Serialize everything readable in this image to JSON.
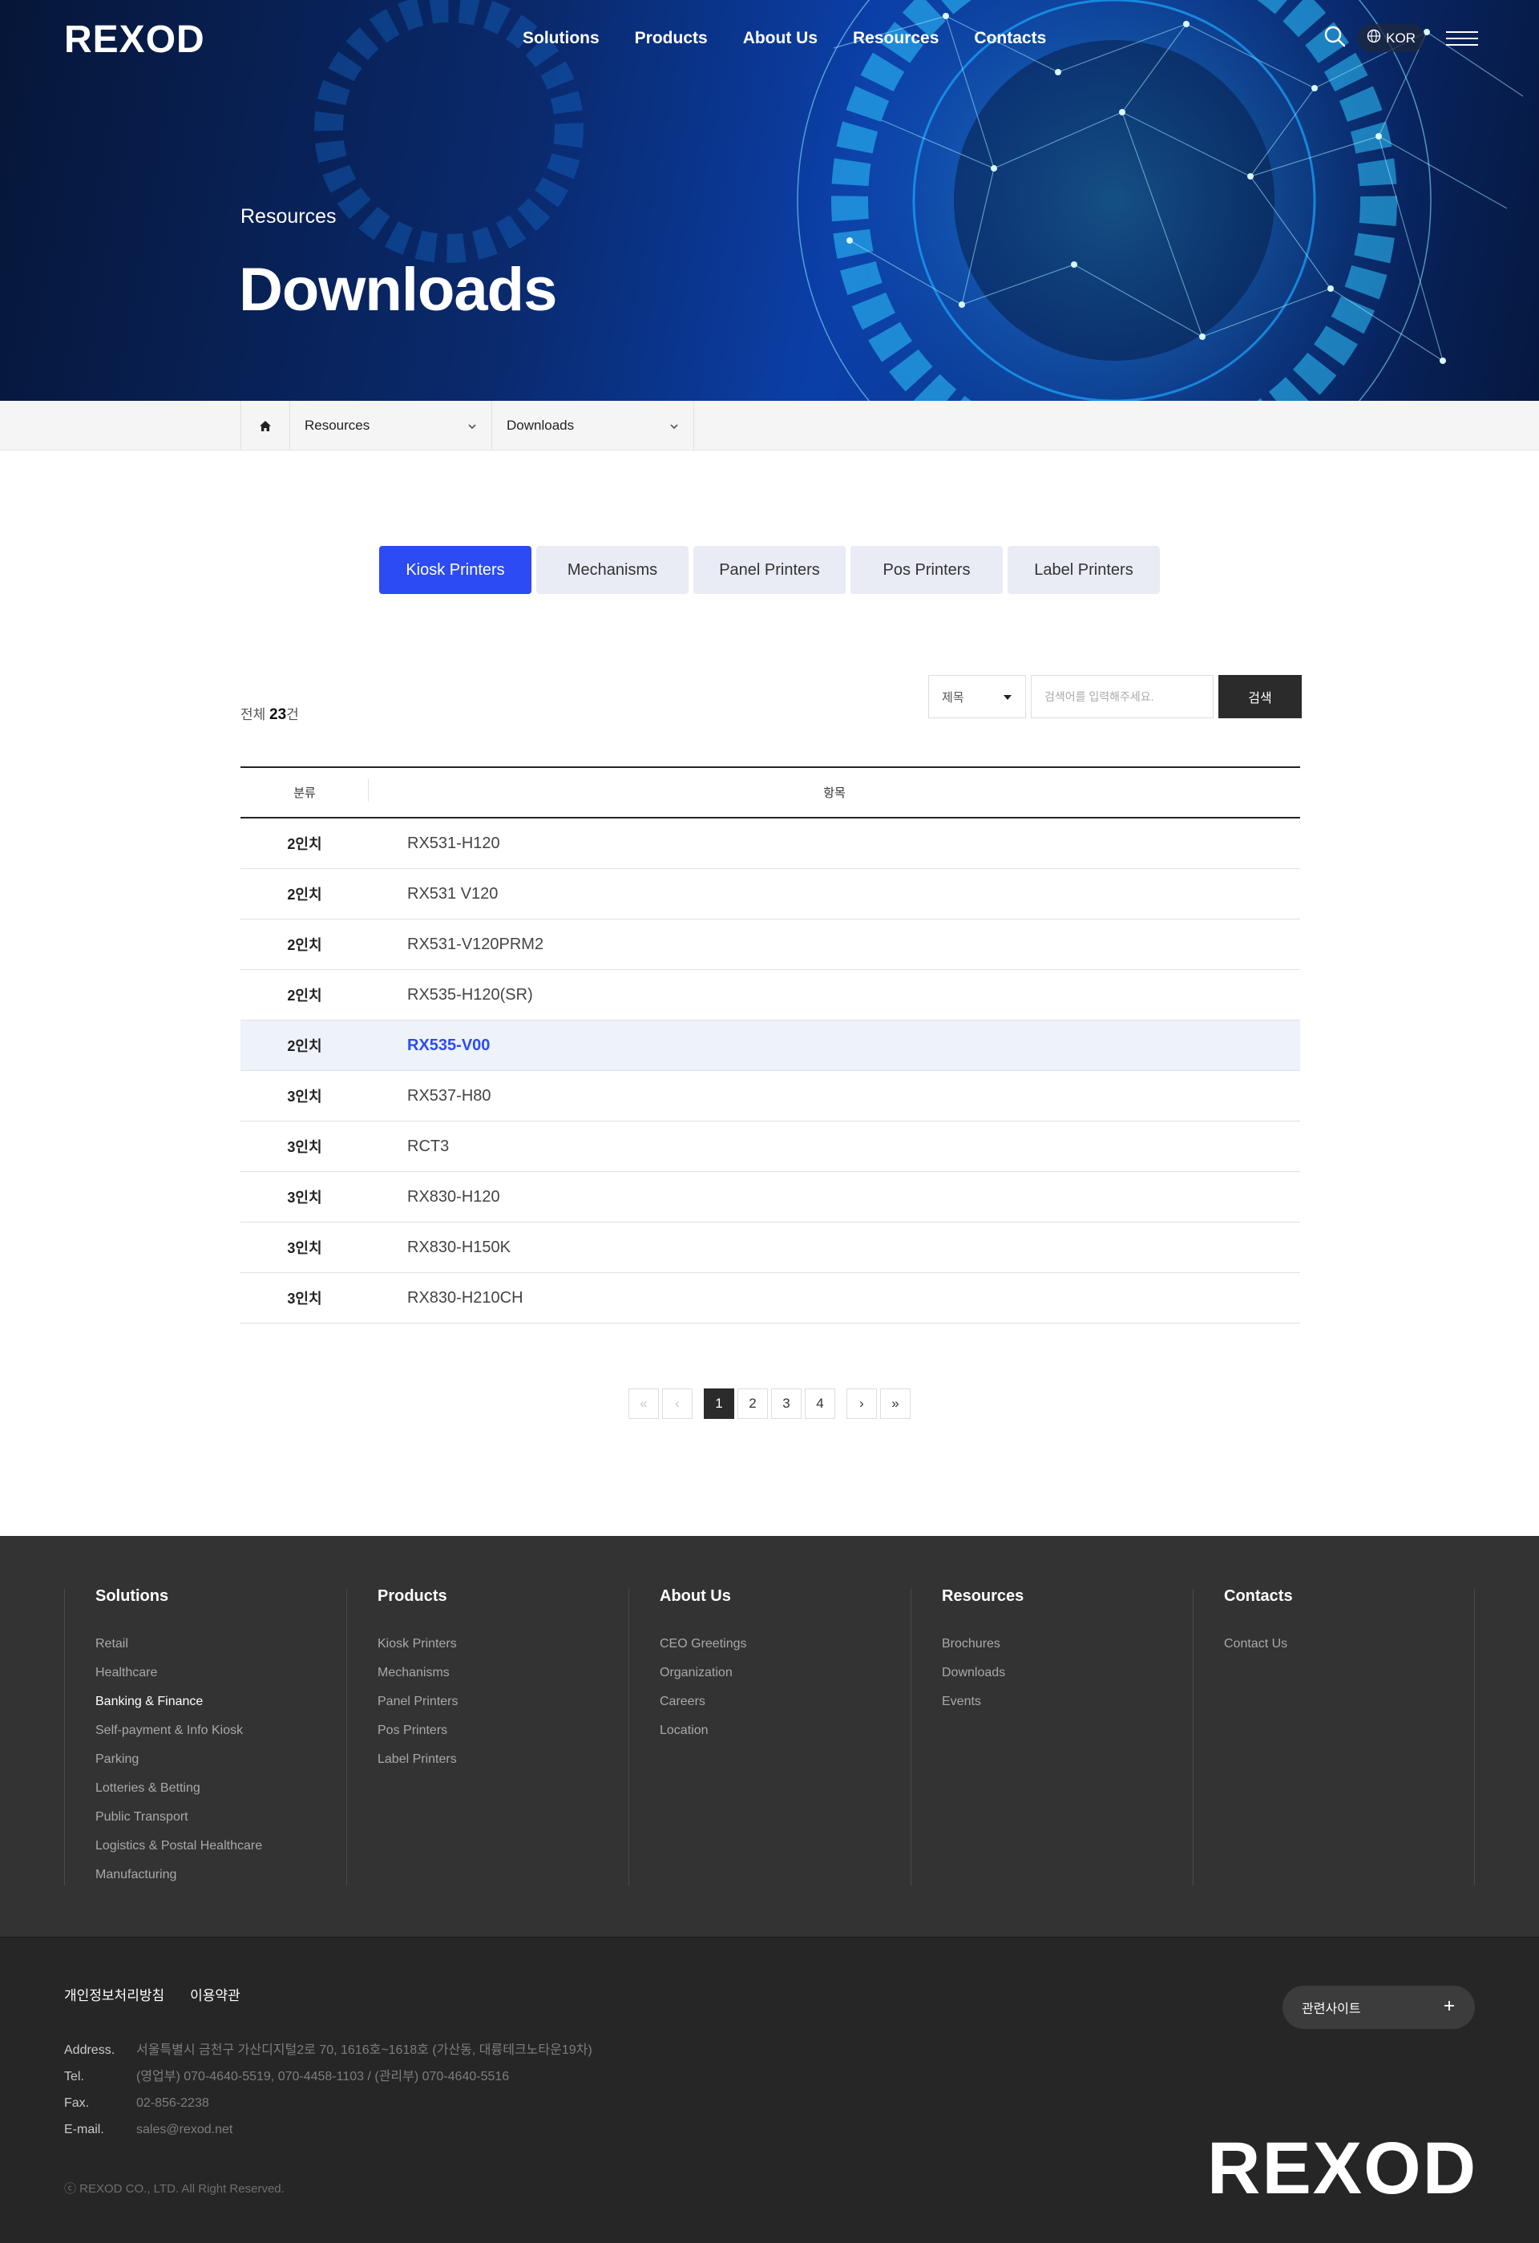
{
  "header": {
    "logo": "REXOD",
    "nav": [
      "Solutions",
      "Products",
      "About Us",
      "Resources",
      "Contacts"
    ],
    "lang": "KOR"
  },
  "hero": {
    "subtitle": "Resources",
    "title": "Downloads"
  },
  "breadcrumb": {
    "level1": "Resources",
    "level2": "Downloads"
  },
  "tabs": [
    "Kiosk Printers",
    "Mechanisms",
    "Panel Printers",
    "Pos Printers",
    "Label Printers"
  ],
  "active_tab": "Kiosk Printers",
  "list": {
    "total_label": "전체",
    "total_count": "23",
    "total_unit": "건",
    "search_select": "제목",
    "search_placeholder": "검색어를 입력해주세요.",
    "search_button": "검색",
    "col_category": "분류",
    "col_item": "항목",
    "rows": [
      {
        "category": "2인치",
        "item": "RX531-H120"
      },
      {
        "category": "2인치",
        "item": "RX531 V120"
      },
      {
        "category": "2인치",
        "item": "RX531-V120PRM2"
      },
      {
        "category": "2인치",
        "item": "RX535-H120(SR)"
      },
      {
        "category": "2인치",
        "item": "RX535-V00"
      },
      {
        "category": "3인치",
        "item": "RX537-H80"
      },
      {
        "category": "3인치",
        "item": "RCT3"
      },
      {
        "category": "3인치",
        "item": "RX830-H120"
      },
      {
        "category": "3인치",
        "item": "RX830-H150K"
      },
      {
        "category": "3인치",
        "item": "RX830-H210CH"
      }
    ]
  },
  "pagination": {
    "pages": [
      "1",
      "2",
      "3",
      "4"
    ],
    "current": "1"
  },
  "footer": {
    "columns": [
      {
        "title": "Solutions",
        "items": [
          "Retail",
          "Healthcare",
          "Banking & Finance",
          "Self-payment & Info Kiosk",
          "Parking",
          "Lotteries & Betting",
          "Public Transport",
          "Logistics & Postal Healthcare",
          "Manufacturing"
        ]
      },
      {
        "title": "Products",
        "items": [
          "Kiosk Printers",
          "Mechanisms",
          "Panel Printers",
          "Pos Printers",
          "Label Printers"
        ]
      },
      {
        "title": "About Us",
        "items": [
          "CEO Greetings",
          "Organization",
          "Careers",
          "Location"
        ]
      },
      {
        "title": "Resources",
        "items": [
          "Brochures",
          "Downloads",
          "Events"
        ]
      },
      {
        "title": "Contacts",
        "items": [
          "Contact Us"
        ]
      }
    ],
    "policy": [
      "개인정보처리방침",
      "이용약관"
    ],
    "info": [
      {
        "label": "Address.",
        "value": "서울특별시 금천구 가산디지털2로 70, 1616호~1618호 (가산동, 대륭테크노타운19차)"
      },
      {
        "label": "Tel.",
        "value": "(영업부) 070-4640-5519, 070-4458-1103 / (관리부) 070-4640-5516"
      },
      {
        "label": "Fax.",
        "value": "02-856-2238"
      },
      {
        "label": "E-mail.",
        "value": "sales@rexod.net"
      }
    ],
    "copyright": "ⓒ REXOD CO., LTD. All Right Reserved.",
    "related_sites": "관련사이트",
    "logo": "REXOD"
  },
  "colors": {
    "accent": "#2c4bf4",
    "hero_dark": "#061638",
    "hero_glow": "#19b8ff",
    "footer_bg": "#333333",
    "footer_bottom_bg": "#262626"
  }
}
